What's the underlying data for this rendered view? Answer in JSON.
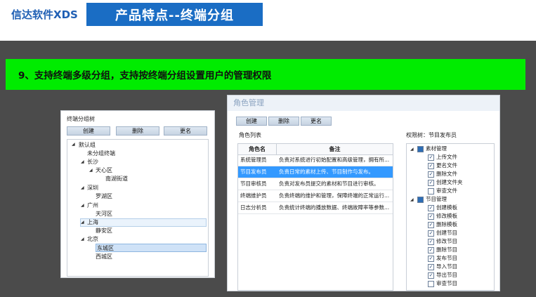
{
  "header": {
    "brand": "信达软件XDS",
    "title": "产品特点--终端分组"
  },
  "feature": {
    "text": "9、支持终端多级分组，支持按终端分组设置用户的管理权限"
  },
  "group_tree_panel": {
    "title": "终端分组树",
    "buttons": {
      "create": "创建",
      "delete": "删除",
      "rename": "更名"
    },
    "nodes": [
      "默认组",
      "未分组终端",
      "长沙",
      "天心区",
      "南湖街道",
      "深圳",
      "罗湖区",
      "广州",
      "天河区",
      "上海",
      "静安区",
      "北京",
      "东城区",
      "西城区"
    ]
  },
  "role_panel": {
    "title": "角色管理",
    "buttons": {
      "create": "创建",
      "delete": "删除",
      "rename": "更名"
    },
    "list_title": "角色列表",
    "col_name": "角色名",
    "col_note": "备注",
    "rows": [
      {
        "name": "系统管理员",
        "note": "负责对系统进行初始配置和高级管理，拥有所..."
      },
      {
        "name": "节目发布员",
        "note": "负责日常的素材上传、节目制作与发布。"
      },
      {
        "name": "节目审核员",
        "note": "负责对发布员提交的素材和节目进行审核。"
      },
      {
        "name": "终端维护员",
        "note": "负责终端的维护和管理，保障终端的正常运行..."
      },
      {
        "name": "日志分析员",
        "note": "负责统计终端的播放数据、终端故障率等参数..."
      }
    ],
    "perm_title": "权限树：节目发布员",
    "perm_groups": [
      {
        "label": "素材管理",
        "items": [
          "上传文件",
          "更名文件",
          "删除文件",
          "创建文件夹",
          "审查文件"
        ]
      },
      {
        "label": "节目管理",
        "items": [
          "创建模板",
          "修改模板",
          "删除模板",
          "创建节目",
          "修改节目",
          "删除节目",
          "发布节目",
          "导入节目",
          "导出节目",
          "审查节目"
        ]
      }
    ]
  }
}
